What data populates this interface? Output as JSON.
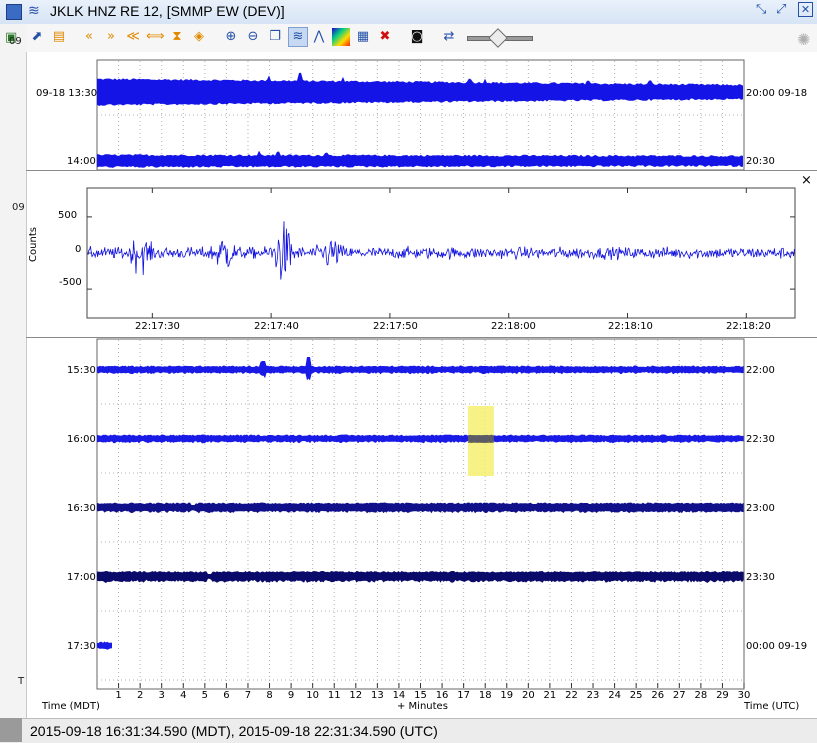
{
  "window": {
    "title": "JKLK HNZ RE 12, [SMMP EW (DEV)]",
    "left_labels": [
      "09",
      "09",
      "T"
    ]
  },
  "toolbar": {
    "icons": [
      "open-icon",
      "save-icon",
      "rewind-icon",
      "fast-forward-icon",
      "fast-back-icon",
      "expand-icon",
      "hourglass-icon",
      "zoom-in-icon",
      "zoom-out-icon",
      "copy-icon",
      "waveform-icon",
      "spectrum-icon",
      "spectrogram-icon",
      "clipboard-icon",
      "close-red-icon",
      "camera-icon",
      "settings-icon"
    ],
    "slider_value": 0.4
  },
  "overview": {
    "left_times": [
      "09-18 13:30",
      "14:00"
    ],
    "right_times": [
      "20:00 09-18",
      "20:30"
    ]
  },
  "zoom": {
    "close_label": "×",
    "ylabel": "Counts",
    "yticks": [
      "500",
      "0",
      "-500"
    ],
    "xticks": [
      "22:17:30",
      "22:17:40",
      "22:17:50",
      "22:18:00",
      "22:18:10",
      "22:18:20"
    ]
  },
  "chart_data": {
    "type": "line",
    "ylabel": "Counts",
    "ylim": [
      -900,
      900
    ],
    "xticks": [
      "22:17:30",
      "22:17:40",
      "22:17:50",
      "22:18:00",
      "22:18:10",
      "22:18:20"
    ],
    "yticks": [
      500,
      0,
      -500
    ],
    "series_color": "#1010e0",
    "noise_amplitude": 100,
    "peaks": [
      {
        "time": "22:17:29",
        "amplitude": 180
      },
      {
        "time": "22:17:36",
        "amplitude": 200
      },
      {
        "time": "22:17:41",
        "amplitude": 330
      },
      {
        "time": "22:17:45",
        "amplitude": 150
      }
    ]
  },
  "helicorder": {
    "left_times": [
      "15:30",
      "16:00",
      "16:30",
      "17:00",
      "17:30"
    ],
    "right_times": [
      "22:00",
      "22:30",
      "23:00",
      "23:30",
      "00:00 09-19"
    ],
    "line_colors": [
      "#1a1ae6",
      "#1a1ae6",
      "#10108a",
      "#0a0a6a",
      "#1a1ae6"
    ],
    "xaxis_left": "Time (MDT)",
    "xaxis_center": "+ Minutes",
    "xaxis_right": "Time (UTC)",
    "minute_labels": [
      "1",
      "2",
      "3",
      "4",
      "5",
      "6",
      "7",
      "8",
      "9",
      "10",
      "11",
      "12",
      "13",
      "14",
      "15",
      "16",
      "17",
      "18",
      "19",
      "20",
      "21",
      "22",
      "23",
      "24",
      "25",
      "26",
      "27",
      "28",
      "29",
      "30"
    ],
    "highlight_color": "#f5f070",
    "highlight_minutes": [
      17.2,
      18.4
    ],
    "highlight_row": 1
  },
  "status": {
    "text": "2015-09-18 16:31:34.590 (MDT), 2015-09-18 22:31:34.590 (UTC)"
  }
}
